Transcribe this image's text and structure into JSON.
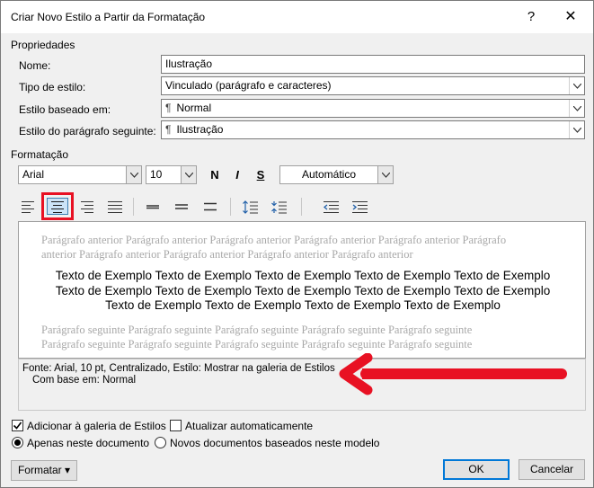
{
  "window": {
    "title": "Criar Novo Estilo a Partir da Formatação",
    "help_glyph": "?",
    "close_glyph": "✕"
  },
  "properties": {
    "section_label": "Propriedades",
    "name_label": "Nome:",
    "name_value": "Ilustração",
    "type_label": "Tipo de estilo:",
    "type_value": "Vinculado (parágrafo e caracteres)",
    "based_label": "Estilo baseado em:",
    "based_value": "Normal",
    "next_label": "Estilo do parágrafo seguinte:",
    "next_value": "Ilustração",
    "pilcrow": "¶"
  },
  "formatting": {
    "section_label": "Formatação",
    "font": "Arial",
    "size": "10",
    "bold": "N",
    "italic": "I",
    "underline": "S",
    "color": "Automático",
    "active_alignment": "center",
    "highlight_color": "#e81123"
  },
  "preview": {
    "previous_paragraph": [
      "Parágrafo anterior Parágrafo anterior Parágrafo anterior Parágrafo anterior Parágrafo anterior Parágrafo",
      "anterior Parágrafo anterior Parágrafo anterior Parágrafo anterior Parágrafo anterior"
    ],
    "sample_text": [
      "Texto de Exemplo Texto de Exemplo Texto de Exemplo Texto de Exemplo Texto de Exemplo",
      "Texto de Exemplo Texto de Exemplo Texto de Exemplo Texto de Exemplo Texto de Exemplo",
      "Texto de Exemplo Texto de Exemplo Texto de Exemplo Texto de Exemplo"
    ],
    "next_paragraph": [
      "Parágrafo seguinte Parágrafo seguinte Parágrafo seguinte Parágrafo seguinte Parágrafo seguinte",
      "Parágrafo seguinte Parágrafo seguinte Parágrafo seguinte Parágrafo seguinte Parágrafo seguinte"
    ]
  },
  "description": {
    "line1": "Fonte: Arial, 10 pt, Centralizado, Estilo: Mostrar na galeria de Estilos",
    "line2": "Com base em: Normal",
    "arrow_color": "#e81123"
  },
  "options": {
    "add_gallery": "Adicionar à galeria de Estilos",
    "add_gallery_checked": true,
    "auto_update": "Atualizar automaticamente",
    "auto_update_checked": false,
    "only_document": "Apenas neste documento",
    "only_document_selected": true,
    "new_documents": "Novos documentos baseados neste modelo",
    "new_documents_selected": false
  },
  "buttons": {
    "format": "Formatar",
    "format_caret": "▾",
    "ok": "OK",
    "cancel": "Cancelar"
  }
}
